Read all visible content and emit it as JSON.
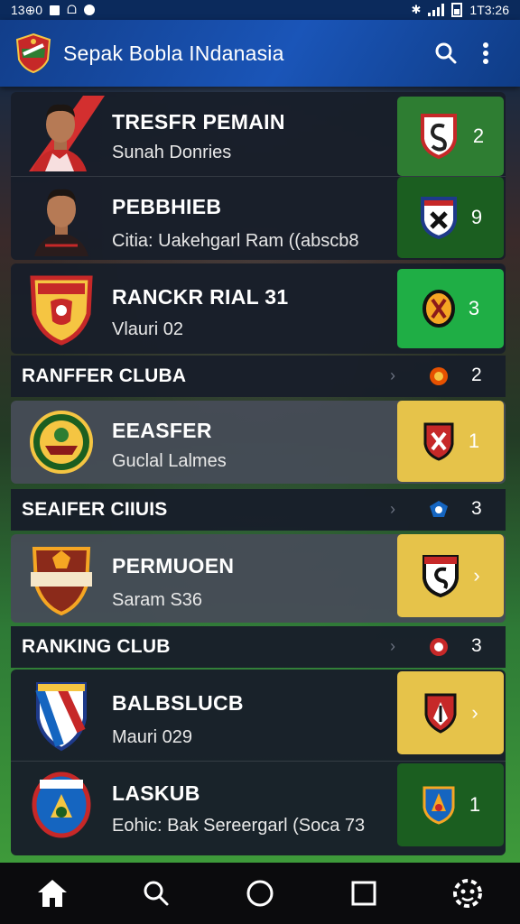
{
  "status_bar": {
    "time_left": "13⊕0",
    "time_right": "1T3:26"
  },
  "app": {
    "title": "Sepak Bobla INdanasia"
  },
  "colors": {
    "app_bar": "#1a55b8",
    "card": "#181e2a",
    "green": "#2e7d32",
    "bright_green": "#1fae45",
    "dark_green": "#1b5e20",
    "yellow": "#e6c34a"
  },
  "icons": {
    "search": "search-icon",
    "more": "more-vert-icon",
    "home": "home-icon",
    "nav_search": "search-icon",
    "circle": "circle-icon",
    "square": "square-icon",
    "assistant": "assistant-icon"
  },
  "rows": [
    {
      "title": "TRESFR PEMAIN",
      "subtitle": "Sunah Donries",
      "value": "2"
    },
    {
      "title": "PEBBHIEB",
      "subtitle": "Citia: Uakehgarl Ram ((abscb8",
      "value": "9"
    },
    {
      "title": "RANCKR RIAL 31",
      "subtitle": "Vlauri 02",
      "value": "3"
    },
    {
      "title": "EEASFER",
      "subtitle": "Guclal Lalmes",
      "value": "1"
    },
    {
      "title": "PERMUOEN",
      "subtitle": "Saram S36",
      "value": "›"
    },
    {
      "title": "BALBSLUCB",
      "subtitle": "Mauri 029",
      "value": "›"
    },
    {
      "title": "LASKUB",
      "subtitle": "Eohic: Bak Sereergarl (Soca 73",
      "value": "1"
    }
  ],
  "sections": [
    {
      "label": "RANFFER CLUBA",
      "chevron": "›",
      "value": "2"
    },
    {
      "label": "SEAIFER CIIUIS",
      "chevron": "›",
      "value": "3"
    },
    {
      "label": "RANKING CLUB",
      "chevron": "›",
      "value": "3"
    }
  ]
}
